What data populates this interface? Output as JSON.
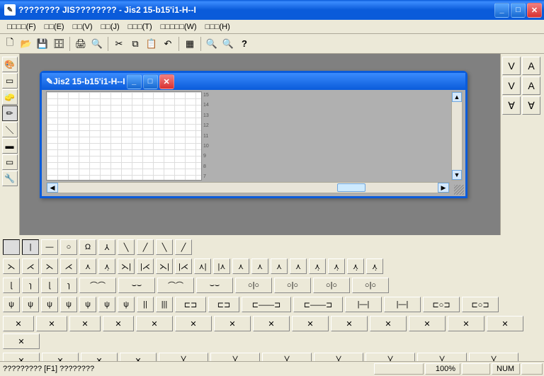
{
  "window": {
    "title": "???????? JIS???????? - Jis2 15-b15'i1-H--I"
  },
  "menu": {
    "items": [
      "□□□□(F)",
      "□□(E)",
      "□□(V)",
      "□□(J)",
      "□□□(T)",
      "□□□□□(W)",
      "□□□(H)"
    ]
  },
  "toolbar": {
    "new": "🗋",
    "open": "📂",
    "save": "💾",
    "saveall": "🗄",
    "print": "🖨",
    "preview": "🔍",
    "cut": "✂",
    "copy": "⧉",
    "paste": "📋",
    "undo": "↶",
    "grid": "▦",
    "zoomin": "🔍+",
    "zoomout": "🔍-",
    "help": "?"
  },
  "vtools": [
    "🎨",
    "▭",
    "🧽",
    "✏",
    "＼",
    "▬",
    "▭",
    "🔧"
  ],
  "rtools": [
    "V",
    "A",
    "V",
    "A",
    "∀",
    "∀"
  ],
  "child": {
    "title": "Jis2 15-b15'i1-H--I",
    "ruler_y": [
      "15",
      "14",
      "13",
      "12",
      "11",
      "10",
      "9",
      "8",
      "7"
    ]
  },
  "status": {
    "left": "????????? [F1] ????????",
    "zoom": "100%",
    "num": "NUM"
  }
}
